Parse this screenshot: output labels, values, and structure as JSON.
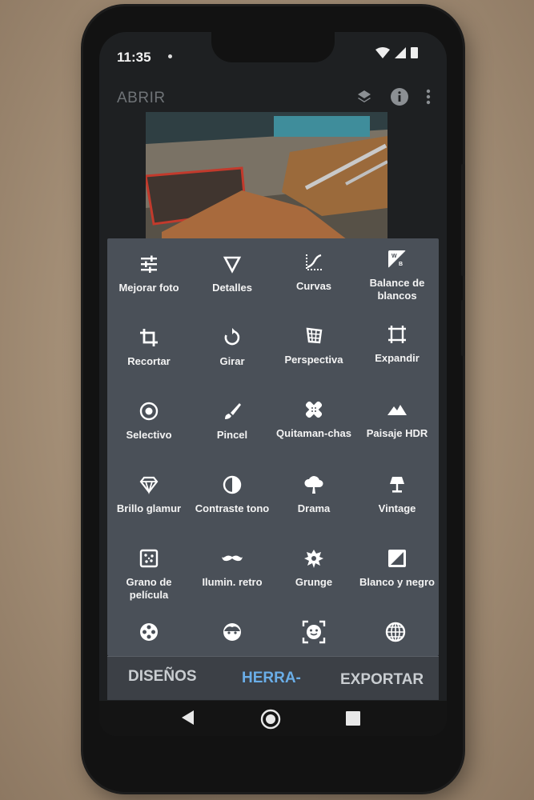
{
  "status_bar": {
    "time": "11:35"
  },
  "app_bar": {
    "open_label": "ABRIR"
  },
  "tools": [
    {
      "label": "Mejorar foto",
      "icon": "tune-icon"
    },
    {
      "label": "Detalles",
      "icon": "details-triangle-icon"
    },
    {
      "label": "Curvas",
      "icon": "curves-icon"
    },
    {
      "label": "Balance de blancos",
      "icon": "white-balance-icon"
    },
    {
      "label": "Recortar",
      "icon": "crop-icon"
    },
    {
      "label": "Girar",
      "icon": "rotate-icon"
    },
    {
      "label": "Perspectiva",
      "icon": "perspective-icon"
    },
    {
      "label": "Expandir",
      "icon": "expand-icon"
    },
    {
      "label": "Selectivo",
      "icon": "selective-icon"
    },
    {
      "label": "Pincel",
      "icon": "brush-icon"
    },
    {
      "label": "Quitaman-chas",
      "icon": "healing-icon"
    },
    {
      "label": "Paisaje HDR",
      "icon": "hdr-landscape-icon"
    },
    {
      "label": "Brillo glamur",
      "icon": "glamour-glow-icon"
    },
    {
      "label": "Contraste tono",
      "icon": "tonal-contrast-icon"
    },
    {
      "label": "Drama",
      "icon": "drama-cloud-icon"
    },
    {
      "label": "Vintage",
      "icon": "vintage-lamp-icon"
    },
    {
      "label": "Grano de película",
      "icon": "film-grain-icon"
    },
    {
      "label": "Ilumin. retro",
      "icon": "retrolux-mustache-icon"
    },
    {
      "label": "Grunge",
      "icon": "grunge-icon"
    },
    {
      "label": "Blanco y negro",
      "icon": "black-white-icon"
    }
  ],
  "partial_tools_icons": [
    "film-reel-icon",
    "face-icon",
    "face-frame-icon",
    "globe-icon"
  ],
  "bottom_tabs": {
    "designs": "DISEÑOS",
    "tools": "HERRA-",
    "export": "EXPORTAR"
  },
  "colors": {
    "panel": "#4a5058",
    "active_tab": "#6aaee8",
    "inactive_tab": "#c9cdd1"
  }
}
